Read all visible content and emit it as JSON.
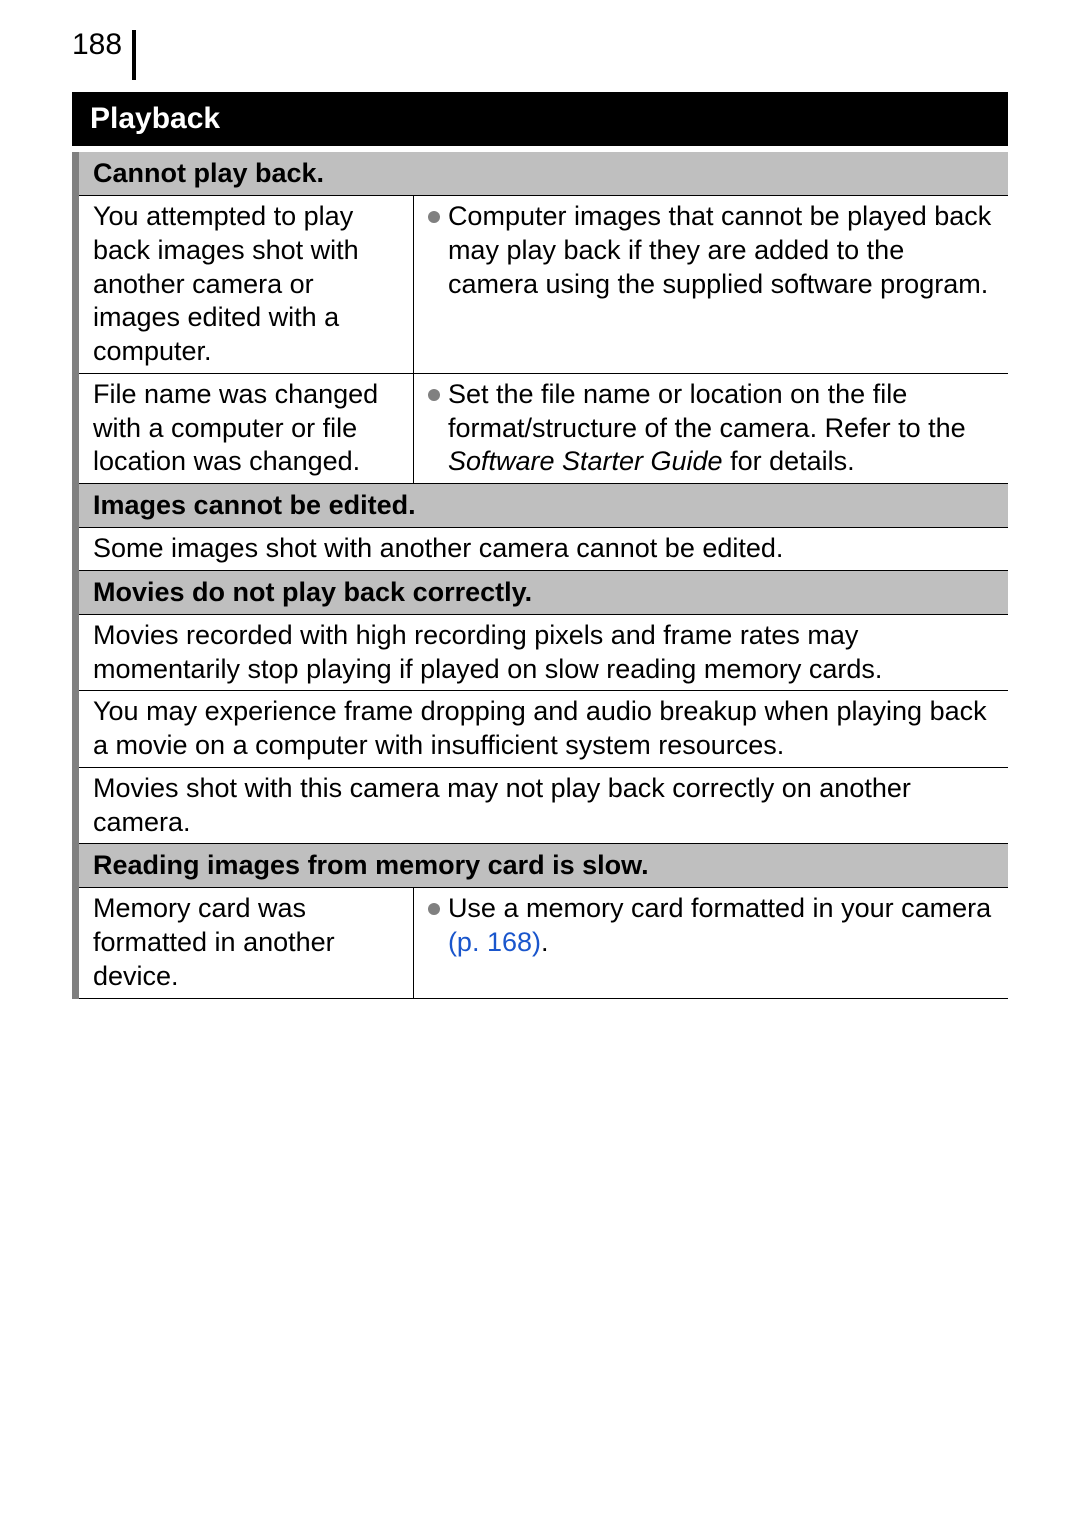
{
  "page_number": "188",
  "section_title": "Playback",
  "groups": [
    {
      "header": "Cannot play back.",
      "rows": [
        {
          "type": "two-col",
          "left": "You attempted to play back images shot with another camera or images edited with a computer.",
          "bullets": [
            {
              "text": "Computer images that cannot be played back may play back if they are added to the camera using the supplied software program."
            }
          ]
        },
        {
          "type": "two-col",
          "left": "File name was changed with a computer or file location was changed.",
          "bullets": [
            {
              "text_pre": "Set the file name or location on the file format/structure of the camera. Refer to the ",
              "italic": "Software Starter Guide",
              "text_post": " for details."
            }
          ]
        }
      ]
    },
    {
      "header": "Images cannot be edited.",
      "rows": [
        {
          "type": "single",
          "text": "Some images shot with another camera cannot be edited."
        }
      ]
    },
    {
      "header": "Movies do not play back correctly.",
      "rows": [
        {
          "type": "single",
          "text": "Movies recorded with high recording pixels and frame rates may momentarily stop playing if played on slow reading memory cards."
        },
        {
          "type": "single",
          "text": "You may experience frame dropping and audio breakup when playing back a movie on a computer with insufficient system resources."
        },
        {
          "type": "single",
          "text": "Movies shot with this camera may not play back correctly on another camera."
        }
      ]
    },
    {
      "header": "Reading images from memory card is slow.",
      "rows": [
        {
          "type": "two-col",
          "left": "Memory card was formatted in another device.",
          "bullets": [
            {
              "text_pre": "Use a memory card formatted in your camera ",
              "link": "(p. 168)",
              "text_post": "."
            }
          ]
        }
      ]
    }
  ]
}
